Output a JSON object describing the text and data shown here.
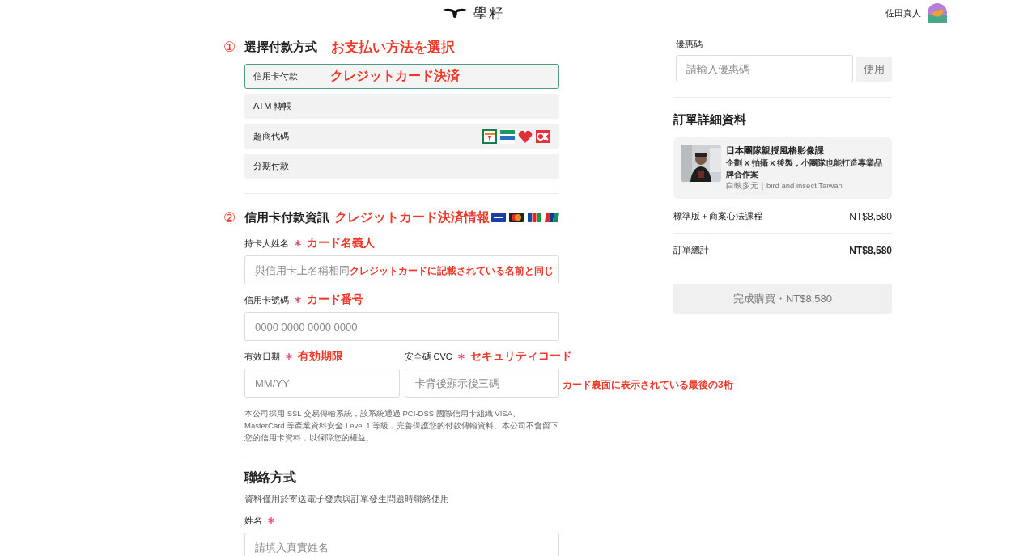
{
  "header": {
    "logo_text": "學籽",
    "user_name": "佐田真人"
  },
  "payment_method": {
    "number": "①",
    "title": "選擇付款方式",
    "annotation": "お支払い方法を選択",
    "options": [
      {
        "label": "信用卡付款",
        "selected": true,
        "annotation": "クレジットカード決済",
        "kind": "plain"
      },
      {
        "label": "ATM 轉帳",
        "selected": false,
        "kind": "plain"
      },
      {
        "label": "超商代碼",
        "selected": false,
        "kind": "stores"
      },
      {
        "label": "分期付款",
        "selected": false,
        "kind": "plain"
      }
    ]
  },
  "card_info": {
    "number": "②",
    "title": "信用卡付款資訊",
    "annotation": "クレジットカード決済情報",
    "rows": [
      [
        {
          "label": "持卡人姓名",
          "required": true,
          "annotation": "カード名義人",
          "placeholder": "與信用卡上名稱相同",
          "placeholder_note": "クレジットカードに記載されている名前と同じ"
        }
      ],
      [
        {
          "label": "信用卡號碼",
          "required": true,
          "annotation": "カード番号",
          "placeholder": "0000 0000 0000 0000"
        }
      ],
      [
        {
          "label": "有效日期",
          "required": true,
          "annotation": "有効期限",
          "placeholder": "MM/YY"
        },
        {
          "label": "安全碼 CVC",
          "required": true,
          "annotation": "セキュリティコード",
          "placeholder": "卡背後顯示後三碼",
          "placeholder_note": "カード裏面に表示されている最後の3桁"
        }
      ]
    ],
    "notice": "本公司採用 SSL 交易傳輸系統，該系統通過 PCI-DSS 國際信用卡組織 VISA、MasterCard 等產業資料安全 Level 1 等級，完善保護您的付款傳輸資料。本公司不會留下您的信用卡資料，以保障您的權益。"
  },
  "contact": {
    "title": "聯絡方式",
    "subtitle": "資料僅用於寄送電子發票與訂單發生問題時聯絡使用",
    "fields": [
      {
        "label": "姓名",
        "required": true,
        "placeholder": "請填入真實姓名"
      }
    ]
  },
  "coupon": {
    "label": "優惠碼",
    "placeholder": "請輸入優惠碼",
    "button": "使用"
  },
  "order": {
    "title": "訂單詳細資料",
    "course": {
      "title": "日本團隊親授風格影像課",
      "subtitle": "企劃 X 拍攝 X 後製，小團隊也能打造專業品牌合作案",
      "author": "白映多元｜bird and insect Taiwan"
    },
    "lines": [
      {
        "label": "標準版＋商案心法課程",
        "amount": "NT$8,580"
      }
    ],
    "total": {
      "label": "訂單總計",
      "amount": "NT$8,580"
    },
    "submit": {
      "label": "完成購買・NT$8,580",
      "disabled": true
    }
  }
}
